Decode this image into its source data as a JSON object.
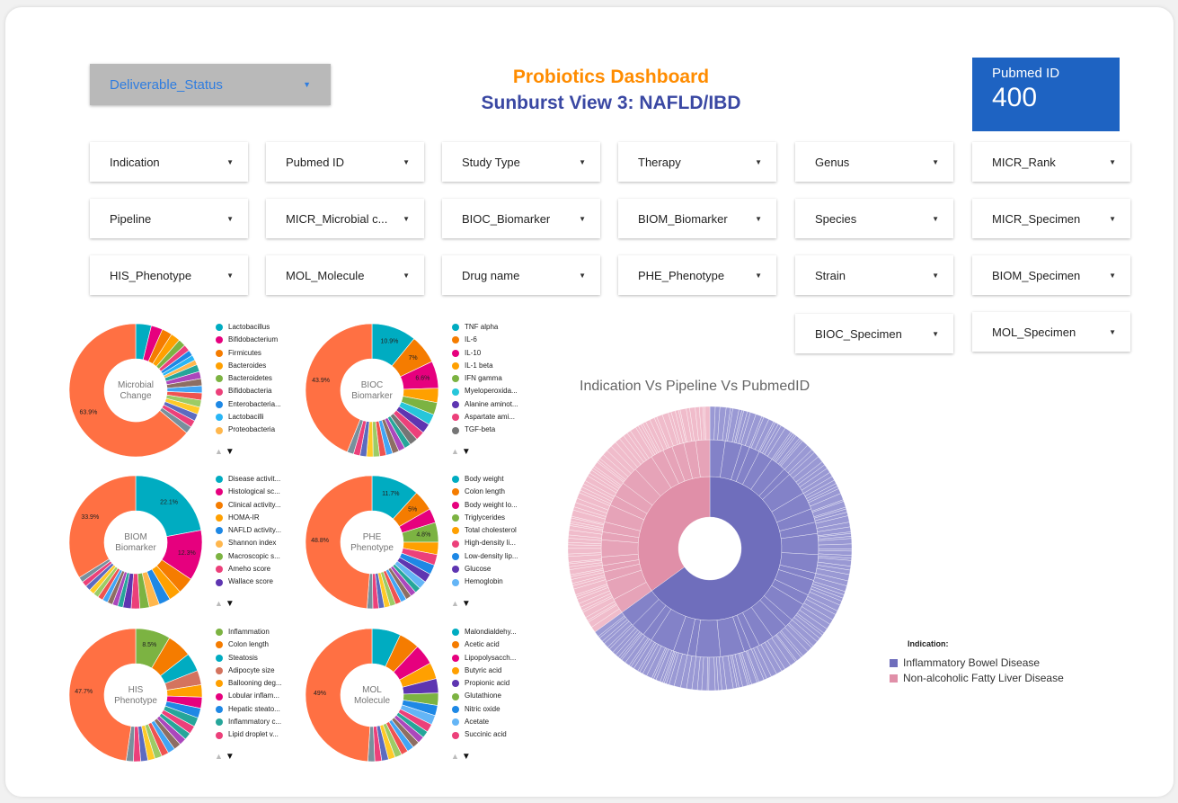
{
  "header": {
    "status_dropdown": "Deliverable_Status",
    "title": "Probiotics Dashboard",
    "subtitle": "Sunburst View 3: NAFLD/IBD",
    "kpi_label": "Pubmed ID",
    "kpi_value": "400"
  },
  "filters": [
    {
      "label": "Indication"
    },
    {
      "label": "Pubmed ID"
    },
    {
      "label": "Study Type"
    },
    {
      "label": "Therapy"
    },
    {
      "label": "Genus"
    },
    {
      "label": "MICR_Rank"
    },
    {
      "label": "Pipeline"
    },
    {
      "label": "MICR_Microbial c..."
    },
    {
      "label": "BIOC_Biomarker"
    },
    {
      "label": "BIOM_Biomarker"
    },
    {
      "label": "Species"
    },
    {
      "label": "MICR_Specimen"
    },
    {
      "label": "HIS_Phenotype"
    },
    {
      "label": "MOL_Molecule"
    },
    {
      "label": "Drug name"
    },
    {
      "label": "PHE_Phenotype"
    },
    {
      "label": "Strain"
    },
    {
      "label": "BIOM_Specimen"
    },
    {
      "label": "BIOC_Specimen"
    },
    {
      "label": "MOL_Specimen"
    }
  ],
  "chart_data": [
    {
      "type": "pie",
      "center_label": [
        "Microbial",
        "Change"
      ],
      "labels": [
        "Lactobacillus",
        "Bifidobacterium",
        "Firmicutes",
        "Bacteroides",
        "Bacteroidetes",
        "Bifidobacteria",
        "Enterobacteria...",
        "Lactobacilli",
        "Proteobacteria"
      ],
      "values": [
        3.8,
        2.8,
        2.5,
        2.3,
        1.8,
        1.6,
        1.4,
        1.3,
        1.2
      ],
      "other": 63.9,
      "other_label": "63.9%",
      "pct_labels": [],
      "colors": [
        "#00acc1",
        "#e6007e",
        "#f57c00",
        "#ffa000",
        "#7cb342",
        "#ec407a",
        "#1e88e5",
        "#29b6f6",
        "#ffb74d"
      ]
    },
    {
      "type": "pie",
      "center_label": [
        "BIOC",
        "Biomarker"
      ],
      "labels": [
        "TNF alpha",
        "IL-6",
        "IL-10",
        "IL-1 beta",
        "IFN gamma",
        "Myeloperoxida...",
        "Alanine aminot...",
        "Aspartate ami...",
        "TGF-beta"
      ],
      "values": [
        10.9,
        7,
        6.6,
        3.5,
        3,
        2.6,
        2.4,
        2.2,
        2
      ],
      "other": 43.9,
      "other_label": "43.9%",
      "pct_labels": [
        "10.9%",
        "7%",
        "6.6%"
      ],
      "colors": [
        "#00acc1",
        "#f57c00",
        "#e6007e",
        "#ffa000",
        "#7cb342",
        "#26c6da",
        "#5e35b1",
        "#ec407a",
        "#757575"
      ]
    },
    {
      "type": "pie",
      "center_label": [
        "BIOM",
        "Biomarker"
      ],
      "labels": [
        "Disease activit...",
        "Histological sc...",
        "Clinical activity...",
        "HOMA-IR",
        "NAFLD activity...",
        "Shannon index",
        "Macroscopic s...",
        "Ameho score",
        "Wallace score"
      ],
      "values": [
        22.1,
        12.3,
        4,
        3,
        2.8,
        2.5,
        2.3,
        2.1,
        2
      ],
      "other": 33.9,
      "other_label": "33.9%",
      "pct_labels": [
        "22.1%",
        "12.3%"
      ],
      "colors": [
        "#00acc1",
        "#e6007e",
        "#f57c00",
        "#ffa000",
        "#1e88e5",
        "#ffb74d",
        "#7cb342",
        "#ec407a",
        "#5e35b1"
      ]
    },
    {
      "type": "pie",
      "center_label": [
        "PHE",
        "Phenotype"
      ],
      "labels": [
        "Body weight",
        "Colon length",
        "Body weight lo...",
        "Triglycerides",
        "Total cholesterol",
        "High-density li...",
        "Low-density lip...",
        "Glucose",
        "Hemoglobin"
      ],
      "values": [
        11.7,
        5,
        3.5,
        4.8,
        3,
        2.6,
        2.4,
        2.2,
        2
      ],
      "other": 48.8,
      "other_label": "48.8%",
      "pct_labels": [
        "11.7%",
        "5%",
        "",
        "4.8%"
      ],
      "colors": [
        "#00acc1",
        "#f57c00",
        "#e6007e",
        "#7cb342",
        "#ffa000",
        "#ec407a",
        "#1e88e5",
        "#5e35b1",
        "#64b5f6"
      ]
    },
    {
      "type": "pie",
      "center_label": [
        "HIS",
        "Phenotype"
      ],
      "labels": [
        "Inflammation",
        "Colon length",
        "Steatosis",
        "Adipocyte size",
        "Ballooning deg...",
        "Lobular inflam...",
        "Hepatic steato...",
        "Inflammatory c...",
        "Lipid droplet v..."
      ],
      "values": [
        8.5,
        6,
        4.5,
        3.5,
        3,
        2.7,
        2.4,
        2.2,
        2
      ],
      "other": 47.7,
      "other_label": "47.7%",
      "pct_labels": [
        "8.5%"
      ],
      "colors": [
        "#7cb342",
        "#f57c00",
        "#00acc1",
        "#d4735e",
        "#ffa000",
        "#e6007e",
        "#1e88e5",
        "#26a69a",
        "#ec407a"
      ]
    },
    {
      "type": "pie",
      "center_label": [
        "MOL",
        "Molecule"
      ],
      "labels": [
        "Malondialdehy...",
        "Acetic acid",
        "Lipopolysacch...",
        "Butyric acid",
        "Propionic acid",
        "Glutathione",
        "Nitric oxide",
        "Acetate",
        "Succinic acid"
      ],
      "values": [
        7,
        5,
        5,
        4,
        3.5,
        3,
        2.5,
        2.3,
        2
      ],
      "other": 49,
      "other_label": "49%",
      "pct_labels": [],
      "colors": [
        "#00acc1",
        "#f57c00",
        "#e6007e",
        "#ffa000",
        "#5e35b1",
        "#7cb342",
        "#1e88e5",
        "#64b5f6",
        "#ec407a"
      ]
    },
    {
      "type": "sunburst",
      "title": "Indication Vs Pipeline Vs PubmedID",
      "legend_title": "Indication:",
      "series": [
        {
          "name": "Inflammatory Bowel Disease",
          "value": 65,
          "color": "#6f6ebc"
        },
        {
          "name": "Non-alcoholic Fatty Liver Disease",
          "value": 35,
          "color": "#e08fa8"
        }
      ]
    }
  ]
}
